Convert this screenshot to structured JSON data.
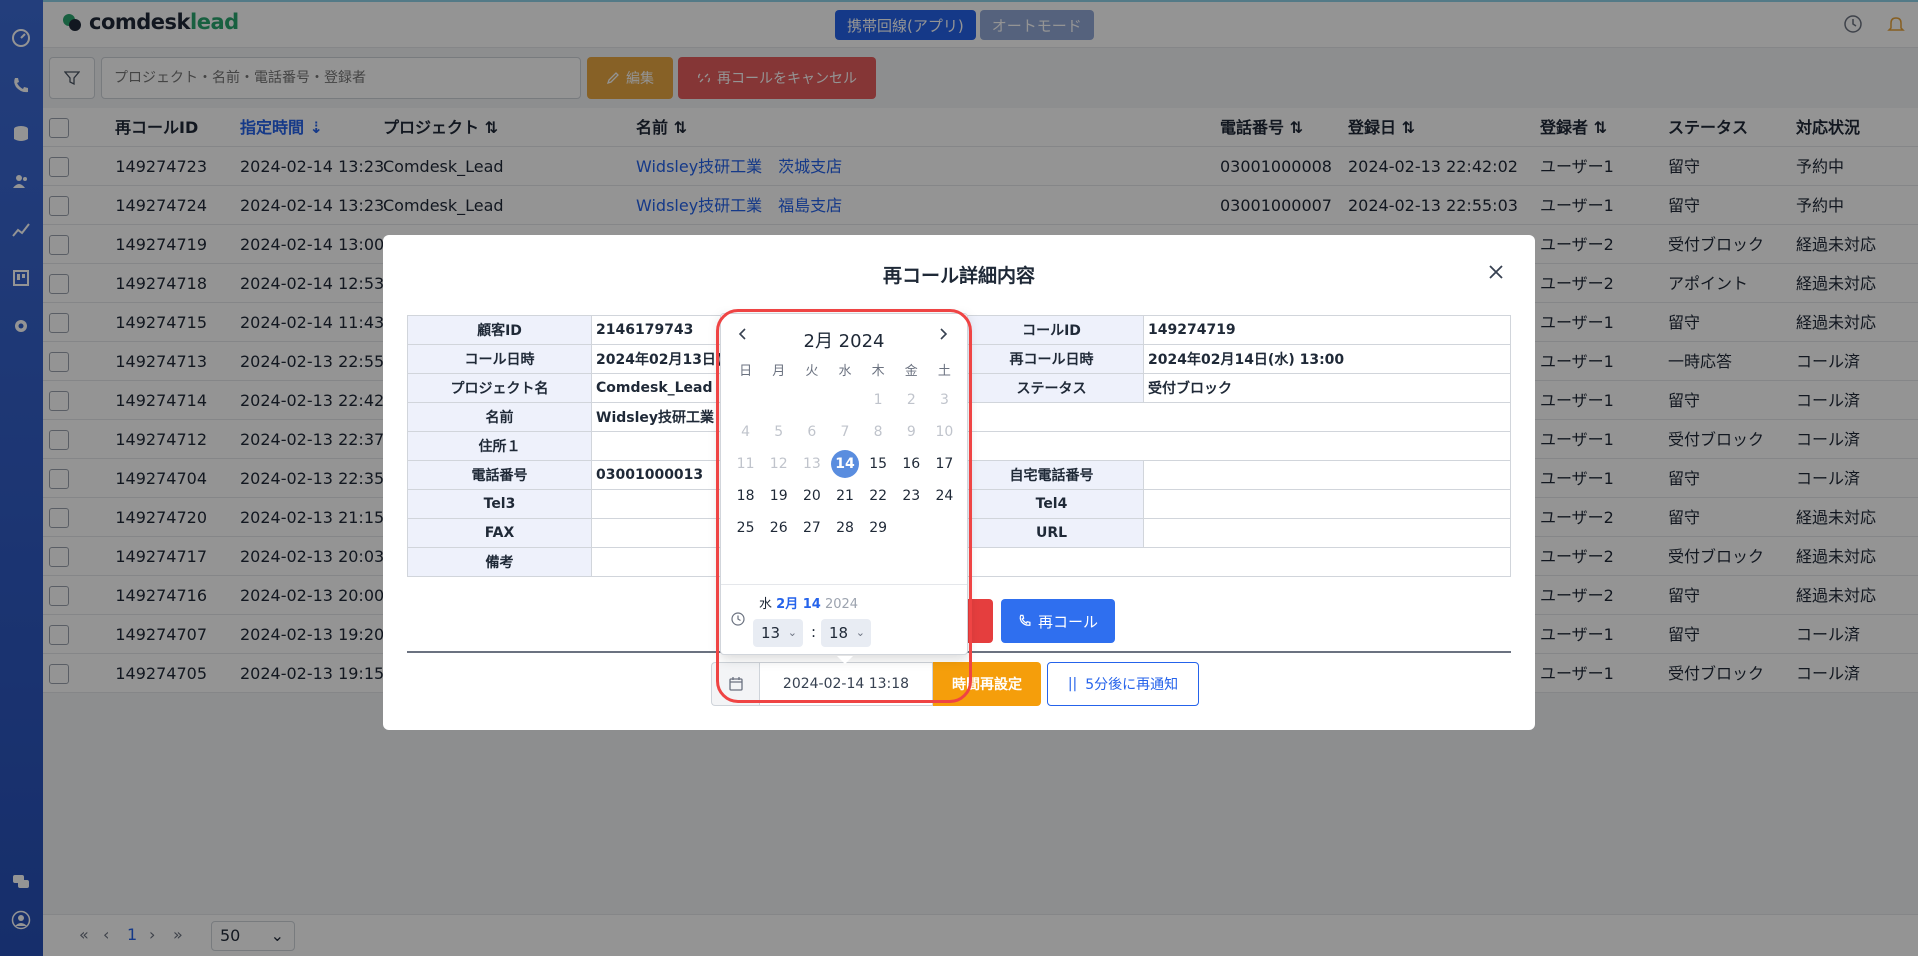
{
  "header": {
    "logo_main": "comdesk",
    "logo_accent": "lead",
    "mode_app": "携帯回線(アプリ)",
    "mode_auto": "オートモード"
  },
  "toolbar": {
    "search_placeholder": "プロジェクト・名前・電話番号・登録者",
    "edit_label": "編集",
    "cancel_label": "再コールをキャンセル"
  },
  "table": {
    "columns": [
      "再コールID",
      "指定時間",
      "プロジェクト",
      "名前",
      "電話番号",
      "登録日",
      "登録者",
      "ステータス",
      "対応状況"
    ],
    "rows": [
      {
        "id": "149274723",
        "time": "2024-02-14 13:23",
        "project": "Comdesk_Lead",
        "name": "Widsley技研工業　茨城支店",
        "phone": "03001000008",
        "registered": "2024-02-13 22:42:02",
        "user": "ユーザー1",
        "status": "留守",
        "state": "予約中"
      },
      {
        "id": "149274724",
        "time": "2024-02-14 13:23",
        "project": "Comdesk_Lead",
        "name": "Widsley技研工業　福島支店",
        "phone": "03001000007",
        "registered": "2024-02-13 22:55:03",
        "user": "ユーザー1",
        "status": "留守",
        "state": "予約中"
      },
      {
        "id": "149274719",
        "time": "2024-02-14 13:00",
        "project": "",
        "name": "",
        "phone": "",
        "registered": "",
        "user": "ユーザー2",
        "status": "受付ブロック",
        "state": "経過未対応"
      },
      {
        "id": "149274718",
        "time": "2024-02-14 12:53",
        "project": "",
        "name": "",
        "phone": "",
        "registered": "",
        "user": "ユーザー2",
        "status": "アポイント",
        "state": "経過未対応"
      },
      {
        "id": "149274715",
        "time": "2024-02-14 11:43",
        "project": "",
        "name": "",
        "phone": "",
        "registered": "",
        "user": "ユーザー1",
        "status": "留守",
        "state": "経過未対応"
      },
      {
        "id": "149274713",
        "time": "2024-02-13 22:55",
        "project": "",
        "name": "",
        "phone": "",
        "registered": "",
        "user": "ユーザー1",
        "status": "一時応答",
        "state": "コール済"
      },
      {
        "id": "149274714",
        "time": "2024-02-13 22:42",
        "project": "",
        "name": "",
        "phone": "",
        "registered": "",
        "user": "ユーザー1",
        "status": "留守",
        "state": "コール済"
      },
      {
        "id": "149274712",
        "time": "2024-02-13 22:37",
        "project": "",
        "name": "",
        "phone": "",
        "registered": "",
        "user": "ユーザー1",
        "status": "受付ブロック",
        "state": "コール済"
      },
      {
        "id": "149274704",
        "time": "2024-02-13 22:35",
        "project": "",
        "name": "",
        "phone": "",
        "registered": "",
        "user": "ユーザー1",
        "status": "留守",
        "state": "コール済"
      },
      {
        "id": "149274720",
        "time": "2024-02-13 21:15",
        "project": "",
        "name": "",
        "phone": "",
        "registered": "",
        "user": "ユーザー2",
        "status": "留守",
        "state": "経過未対応"
      },
      {
        "id": "149274717",
        "time": "2024-02-13 20:03",
        "project": "",
        "name": "",
        "phone": "",
        "registered": "",
        "user": "ユーザー2",
        "status": "受付ブロック",
        "state": "経過未対応"
      },
      {
        "id": "149274716",
        "time": "2024-02-13 20:00",
        "project": "",
        "name": "",
        "phone": "",
        "registered": "",
        "user": "ユーザー2",
        "status": "留守",
        "state": "経過未対応"
      },
      {
        "id": "149274707",
        "time": "2024-02-13 19:20",
        "project": "",
        "name": "",
        "phone": "",
        "registered": "",
        "user": "ユーザー1",
        "status": "留守",
        "state": "コール済"
      },
      {
        "id": "149274705",
        "time": "2024-02-13 19:15",
        "project": "",
        "name": "",
        "phone": "",
        "registered": "",
        "user": "ユーザー1",
        "status": "受付ブロック",
        "state": "コール済"
      }
    ]
  },
  "pager": {
    "current": "1",
    "page_size": "50"
  },
  "modal": {
    "title": "再コール詳細内容",
    "fields": {
      "customer_id_label": "顧客ID",
      "customer_id": "2146179743",
      "call_time_label": "コール日時",
      "call_time": "2024年02月13日(",
      "project_label": "プロジェクト名",
      "project": "Comdesk_Lead",
      "name_label": "名前",
      "name": "Widsley技研工業",
      "address_label": "住所１",
      "address": "",
      "phone_label": "電話番号",
      "phone": "03001000013",
      "tel3_label": "Tel3",
      "tel3": "",
      "fax_label": "FAX",
      "fax": "",
      "memo_label": "備考",
      "memo": "",
      "call_id_label": "コールID",
      "call_id": "149274719",
      "recall_time_label": "再コール日時",
      "recall_time": "2024年02月14日(水) 13:00",
      "status_label": "ステータス",
      "status": "受付ブロック",
      "home_phone_label": "自宅電話番号",
      "home_phone": "",
      "tel4_label": "Tel4",
      "tel4": "",
      "url_label": "URL",
      "url": ""
    },
    "recall_button": "再コール",
    "date_value": "2024-02-14 13:18",
    "reset_button": "時間再設定",
    "snooze_button": "5分後に再通知"
  },
  "calendar": {
    "title": "2月 2024",
    "weekdays": [
      "日",
      "月",
      "火",
      "水",
      "木",
      "金",
      "土"
    ],
    "weeks": [
      [
        "",
        "",
        "",
        "",
        "1",
        "2",
        "3"
      ],
      [
        "4",
        "5",
        "6",
        "7",
        "8",
        "9",
        "10"
      ],
      [
        "11",
        "12",
        "13",
        "14",
        "15",
        "16",
        "17"
      ],
      [
        "18",
        "19",
        "20",
        "21",
        "22",
        "23",
        "24"
      ],
      [
        "25",
        "26",
        "27",
        "28",
        "29",
        "",
        ""
      ]
    ],
    "selected": "14",
    "disabled_through": 13,
    "time_weekday": "水",
    "time_month_day": "2月 14",
    "time_year": "2024",
    "hour": "13",
    "minute": "18"
  }
}
